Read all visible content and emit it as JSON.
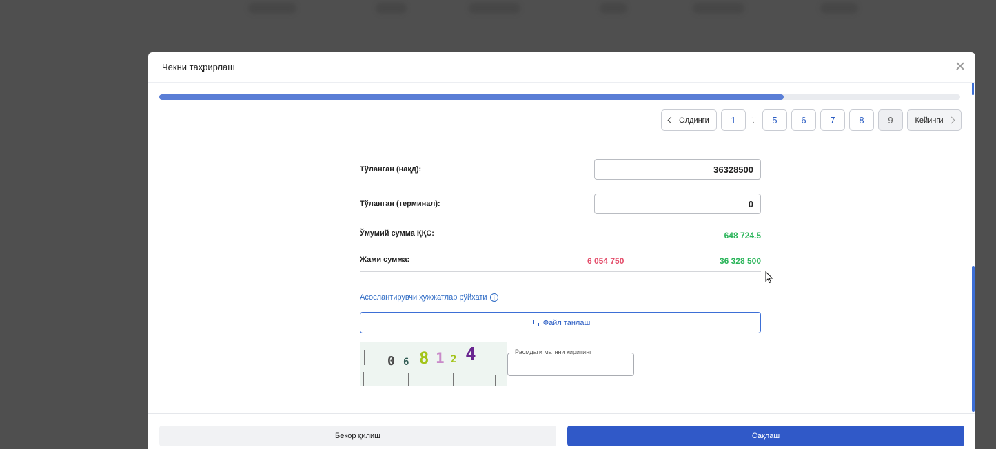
{
  "modal": {
    "title": "Чекни таҳрирлаш",
    "progress_fraction": 0.78
  },
  "pagination": {
    "prev_label": "Олдинги",
    "next_label": "Кейинги",
    "pages": [
      "1",
      "5",
      "6",
      "7",
      "8",
      "9"
    ],
    "active_page": "9"
  },
  "form": {
    "paid_cash_label": "Тўланган (нақд):",
    "paid_cash_value": "36328500",
    "paid_terminal_label": "Тўланган (терминал):",
    "paid_terminal_value": "0",
    "vat_total_label": "Ўмумий сумма ҚҚС:",
    "vat_total_value": "648 724.5",
    "grand_total_label": "Жами сумма:",
    "grand_total_red": "6 054 750",
    "grand_total_green": "36 328 500"
  },
  "documents": {
    "link_label": "Асослантирувчи ҳужжатлар рўйхати",
    "file_button_label": "Файл танлаш"
  },
  "captcha": {
    "chars": [
      "0",
      "6",
      "8",
      "1",
      "2",
      "4"
    ],
    "field_label": "Расмдаги матнни киритинг",
    "field_value": ""
  },
  "footer": {
    "cancel_label": "Бекор қилиш",
    "save_label": "Сақлаш"
  },
  "colors": {
    "accent": "#3059c8",
    "positive": "#2bb55a",
    "negative": "#e44e6b"
  }
}
